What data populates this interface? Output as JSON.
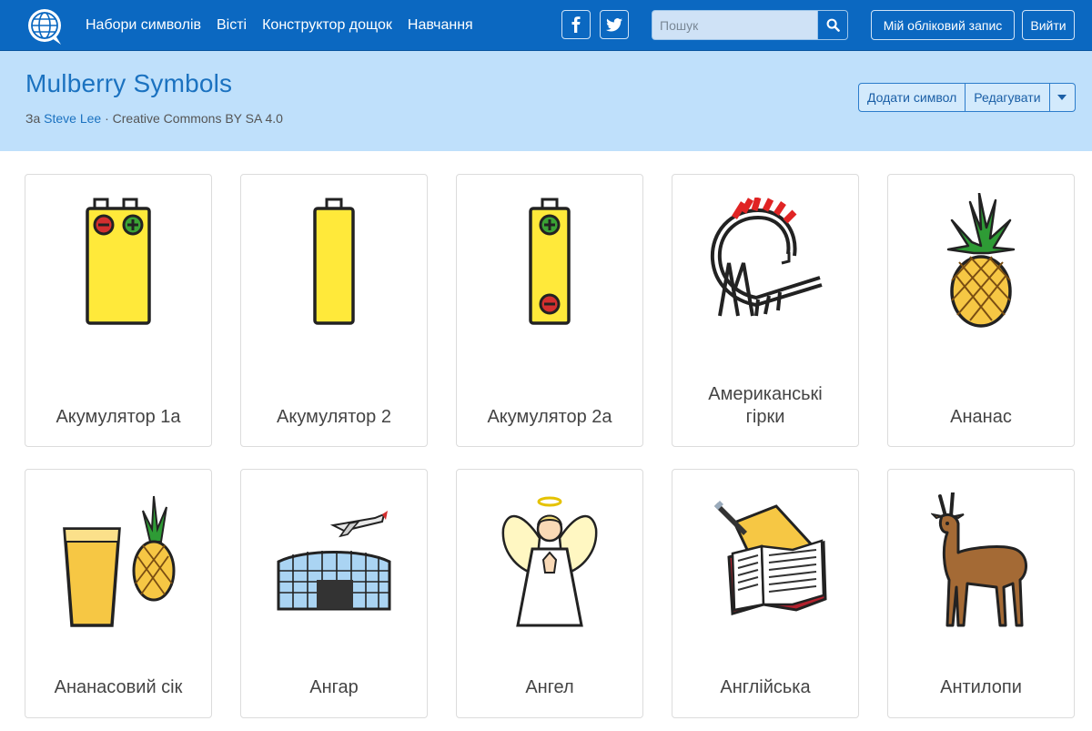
{
  "nav": {
    "links": [
      "Набори символів",
      "Вісті",
      "Конструктор дощок",
      "Навчання"
    ],
    "search_placeholder": "Пошук",
    "account_label": "Мій обліковий запис",
    "logout_label": "Вийти"
  },
  "header": {
    "title": "Mulberry Symbols",
    "byline_prefix": "За",
    "author": "Steve Lee",
    "license": "· Creative Commons BY SA 4.0",
    "add_symbol_label": "Додати символ",
    "edit_label": "Редагувати"
  },
  "symbols": [
    {
      "label": "Акумулятор 1а"
    },
    {
      "label": "Акумулятор 2"
    },
    {
      "label": "Акумулятор 2а"
    },
    {
      "label_line1": "Американські",
      "label_line2": "гірки"
    },
    {
      "label": "Ананас"
    },
    {
      "label": "Ананасовий сік"
    },
    {
      "label": "Ангар"
    },
    {
      "label": "Ангел"
    },
    {
      "label": "Англійська"
    },
    {
      "label": "Антилопи"
    }
  ],
  "colors": {
    "navbar": "#0b68c1",
    "header_band": "#bfe0fb",
    "title": "#1b72c0"
  }
}
